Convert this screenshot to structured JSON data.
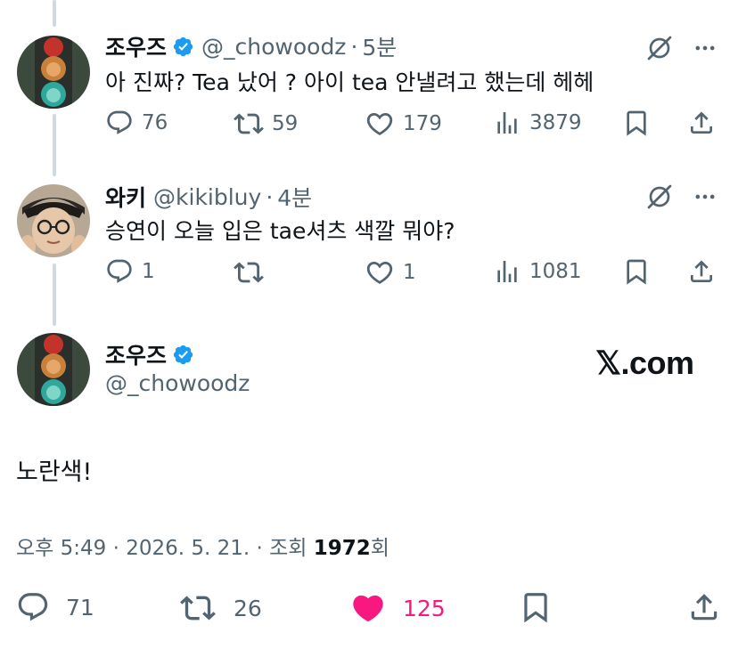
{
  "replies": [
    {
      "name": "조우즈",
      "verified": true,
      "handle": "@_chowoodz",
      "time": "5분",
      "text": "아 진짜? Tea 났어 ? 아이 tea 안낼려고 했는데 헤헤",
      "stats": {
        "replies": "76",
        "reposts": "59",
        "likes": "179",
        "views": "3879"
      }
    },
    {
      "name": "와키",
      "verified": false,
      "handle": "@kikibluy",
      "time": "4분",
      "text": "승연이 오늘 입은 tae셔츠 색깔 뭐야?",
      "stats": {
        "replies": "1",
        "reposts": "",
        "likes": "1",
        "views": "1081"
      }
    }
  ],
  "main": {
    "name": "조우즈",
    "handle": "@_chowoodz",
    "text": "노란색!",
    "time_prefix": "오후 5:49 · 2026. 5. 21. · 조회 ",
    "views": "1972",
    "views_suffix": "회",
    "stats": {
      "replies": "71",
      "reposts": "26",
      "likes": "125"
    },
    "liked": true
  },
  "brand": {
    "logo": "𝕏",
    "site": ".com"
  },
  "icons": [
    "verified-badge-icon",
    "grok-icon",
    "more-icon",
    "reply-icon",
    "repost-icon",
    "like-icon",
    "views-icon",
    "bookmark-icon",
    "share-icon"
  ],
  "colors": {
    "text": "#0f1419",
    "secondary": "#536471",
    "verified": "#1d9bf0",
    "like": "#f91880",
    "thread_line": "#cfd9de"
  }
}
